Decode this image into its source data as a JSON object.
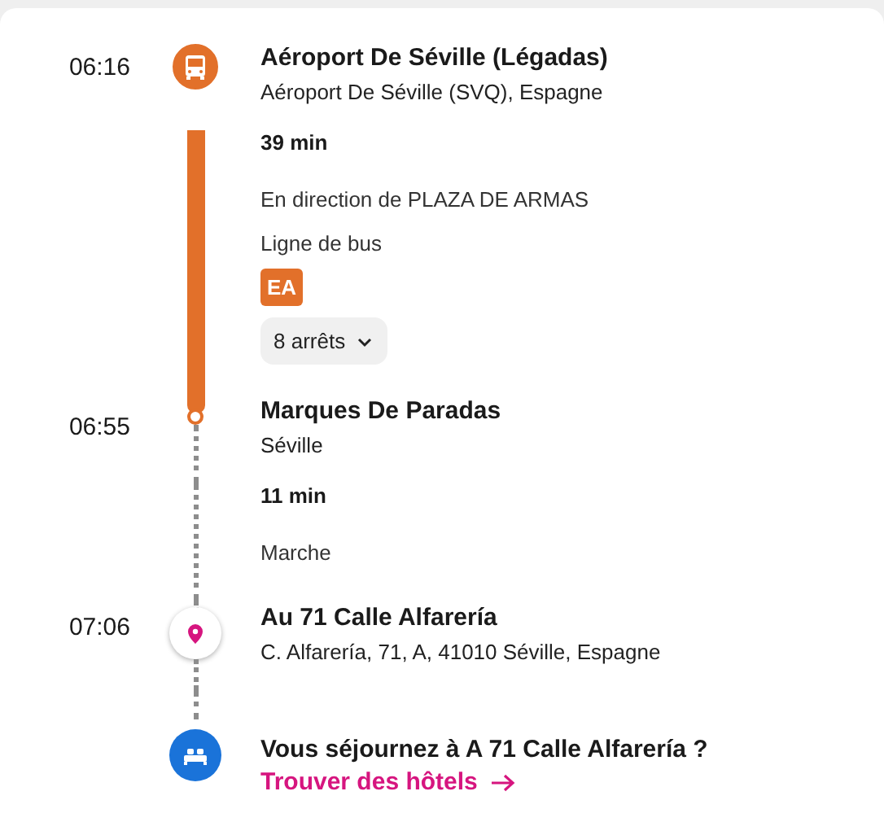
{
  "timeline": [
    {
      "kind": "bus_stop",
      "time": "06:16",
      "name": "Aéroport De Séville (Légadas)",
      "address": "Aéroport De Séville (SVQ), Espagne"
    },
    {
      "kind": "bus_leg",
      "duration": "39 min",
      "direction": "En direction de PLAZA DE ARMAS",
      "line_label": "Ligne de bus",
      "line_badge": "EA",
      "stops_button": "8 arrêts",
      "expanded": false
    },
    {
      "kind": "transfer_stop",
      "time": "06:55",
      "name": "Marques De Paradas",
      "address": "Séville"
    },
    {
      "kind": "walk_leg",
      "duration": "11 min",
      "direction": "Marche"
    },
    {
      "kind": "destination",
      "time": "07:06",
      "name": "Au 71 Calle Alfarería",
      "address": "C. Alfarería, 71, A, 41010 Séville, Espagne"
    },
    {
      "kind": "hotel_prompt",
      "question": "Vous séjournez à A 71 Calle Alfarería ?",
      "link": "Trouver des hôtels"
    }
  ]
}
